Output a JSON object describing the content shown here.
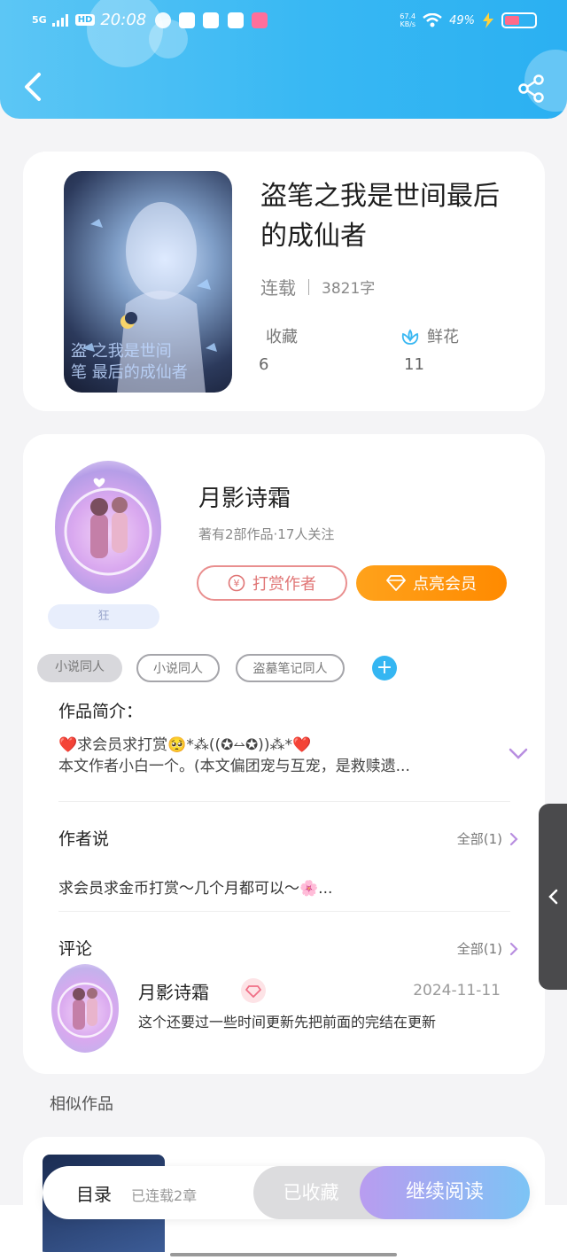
{
  "status_bar": {
    "network": "5G",
    "hd": "HD",
    "time": "20:08",
    "speed_value": "67.4",
    "speed_unit": "KB/s",
    "battery": "49%",
    "battery_level": 0.49
  },
  "colors": {
    "header_accent": "#38b8f3",
    "tip_border": "#e98f8f",
    "vip_orange": "#ff9a0f",
    "tag_add": "#35b6f2",
    "continue_gradient_start": "#b99cf0",
    "continue_gradient_end": "#7cc4f5"
  },
  "header": {
    "back_icon": "chevron-left-icon",
    "share_icon": "share-icon"
  },
  "book": {
    "title": "盗笔之我是世间最后的成仙者",
    "status": "连载",
    "word_count": "3821字",
    "stats": [
      {
        "label": "收藏",
        "value": "6"
      },
      {
        "label": "鲜花",
        "value": "11",
        "icon": "flower-icon"
      }
    ]
  },
  "author": {
    "name": "月影诗霜",
    "info": "著有2部作品·17人关注",
    "badge": "狂",
    "tip_button": "打赏作者",
    "vip_button": "点亮会员",
    "tags": [
      "小说同人",
      "小说同人",
      "盗墓笔记同人"
    ]
  },
  "intro": {
    "label": "作品简介：",
    "line1": "❤️求会员求打赏🥺*⁂((✪⥎✪))⁂*❤️",
    "line2": "本文作者小白一个。(本文偏团宠与互宠，是救赎遗..."
  },
  "author_note": {
    "title": "作者说",
    "view_all": "全部(1)",
    "text": "求会员求金币打赏～几个月都可以～🌸..."
  },
  "comments": {
    "title": "评论",
    "view_all": "全部(1)",
    "items": [
      {
        "user": "月影诗霜",
        "date": "2024-11-11",
        "text": "这个还要过一些时间更新先把前面的完结在更新"
      }
    ]
  },
  "similar": {
    "title": "相似作品"
  },
  "bottom_bar": {
    "toc": "目录",
    "toc_sub": "已连载2章",
    "collected": "已收藏",
    "continue": "继续阅读"
  }
}
